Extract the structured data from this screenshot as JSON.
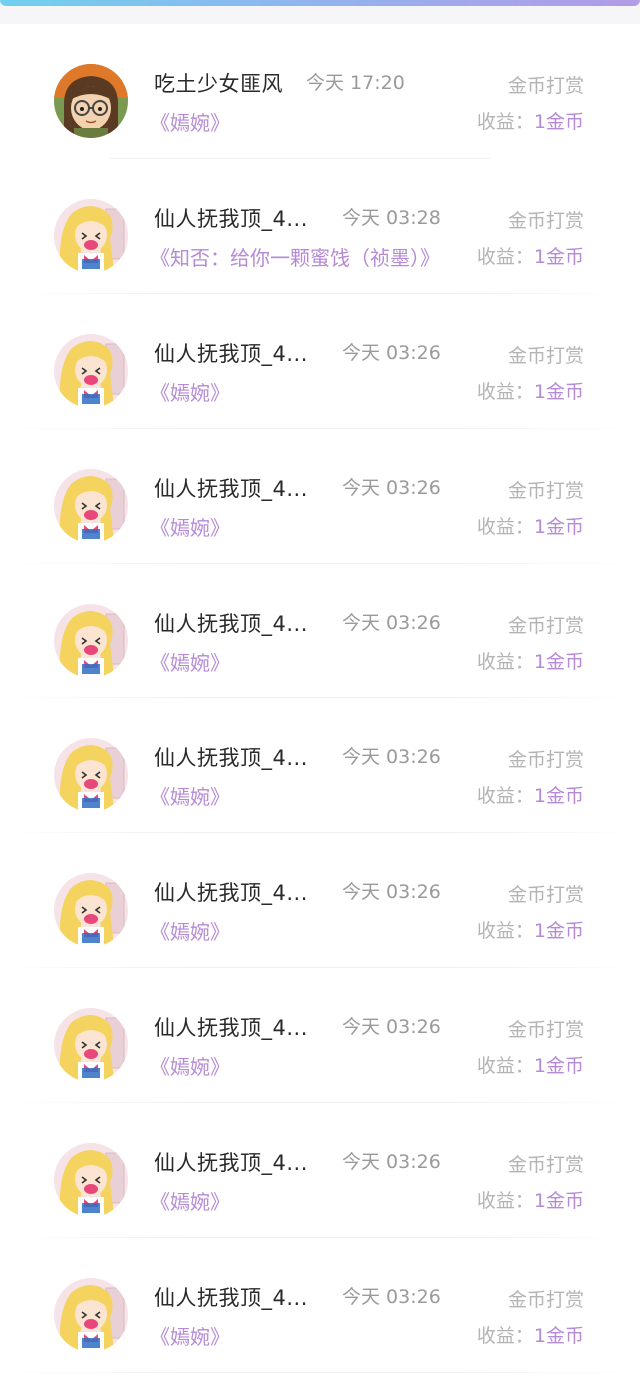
{
  "colors": {
    "accent": "#b58ad6",
    "name_text": "#2a2a2a",
    "muted_text": "#9a9a9a",
    "gradient_start": "#6fd0ee",
    "gradient_end": "#b39be6"
  },
  "rewards": [
    {
      "avatar": "girl-glasses-avatar",
      "name": "吃土少女匪风",
      "time": "今天 17:20",
      "work": "《嫣婉》",
      "reward_type": "金币打赏",
      "income_label": "收益：",
      "income_amount": "1金币"
    },
    {
      "avatar": "sailor-moon-avatar",
      "name": "仙人抚我顶_4...",
      "time": "今天 03:28",
      "work": "《知否：给你一颗蜜饯（祯墨）》",
      "reward_type": "金币打赏",
      "income_label": "收益：",
      "income_amount": "1金币"
    },
    {
      "avatar": "sailor-moon-avatar",
      "name": "仙人抚我顶_4...",
      "time": "今天 03:26",
      "work": "《嫣婉》",
      "reward_type": "金币打赏",
      "income_label": "收益：",
      "income_amount": "1金币"
    },
    {
      "avatar": "sailor-moon-avatar",
      "name": "仙人抚我顶_4...",
      "time": "今天 03:26",
      "work": "《嫣婉》",
      "reward_type": "金币打赏",
      "income_label": "收益：",
      "income_amount": "1金币"
    },
    {
      "avatar": "sailor-moon-avatar",
      "name": "仙人抚我顶_4...",
      "time": "今天 03:26",
      "work": "《嫣婉》",
      "reward_type": "金币打赏",
      "income_label": "收益：",
      "income_amount": "1金币"
    },
    {
      "avatar": "sailor-moon-avatar",
      "name": "仙人抚我顶_4...",
      "time": "今天 03:26",
      "work": "《嫣婉》",
      "reward_type": "金币打赏",
      "income_label": "收益：",
      "income_amount": "1金币"
    },
    {
      "avatar": "sailor-moon-avatar",
      "name": "仙人抚我顶_4...",
      "time": "今天 03:26",
      "work": "《嫣婉》",
      "reward_type": "金币打赏",
      "income_label": "收益：",
      "income_amount": "1金币"
    },
    {
      "avatar": "sailor-moon-avatar",
      "name": "仙人抚我顶_4...",
      "time": "今天 03:26",
      "work": "《嫣婉》",
      "reward_type": "金币打赏",
      "income_label": "收益：",
      "income_amount": "1金币"
    },
    {
      "avatar": "sailor-moon-avatar",
      "name": "仙人抚我顶_4...",
      "time": "今天 03:26",
      "work": "《嫣婉》",
      "reward_type": "金币打赏",
      "income_label": "收益：",
      "income_amount": "1金币"
    },
    {
      "avatar": "sailor-moon-avatar",
      "name": "仙人抚我顶_4...",
      "time": "今天 03:26",
      "work": "《嫣婉》",
      "reward_type": "金币打赏",
      "income_label": "收益：",
      "income_amount": "1金币"
    }
  ]
}
